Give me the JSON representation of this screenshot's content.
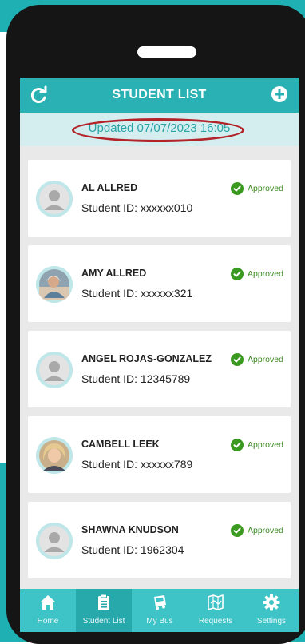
{
  "header": {
    "title": "STUDENT LIST",
    "refresh_icon": "refresh-icon",
    "add_icon": "add-icon"
  },
  "updated": {
    "text": "Updated 07/07/2023 16:05",
    "highlight_color": "#b3232a"
  },
  "students": [
    {
      "name": "AL ALLRED",
      "student_id": "Student ID: xxxxxx010",
      "status": "Approved",
      "avatar": "placeholder"
    },
    {
      "name": "AMY ALLRED",
      "student_id": "Student ID: xxxxxx321",
      "status": "Approved",
      "avatar": "photo"
    },
    {
      "name": "ANGEL ROJAS-GONZALEZ",
      "student_id": "Student ID: 12345789",
      "status": "Approved",
      "avatar": "placeholder"
    },
    {
      "name": "CAMBELL LEEK",
      "student_id": "Student ID: xxxxxx789",
      "status": "Approved",
      "avatar": "photo"
    },
    {
      "name": "SHAWNA KNUDSON",
      "student_id": "Student ID: 1962304",
      "status": "Approved",
      "avatar": "placeholder"
    }
  ],
  "tabs": [
    {
      "label": "Home",
      "icon": "home-icon",
      "active": false
    },
    {
      "label": "Student List",
      "icon": "clipboard-icon",
      "active": true
    },
    {
      "label": "My Bus",
      "icon": "bus-icon",
      "active": false
    },
    {
      "label": "Requests",
      "icon": "map-icon",
      "active": false
    },
    {
      "label": "Settings",
      "icon": "gear-icon",
      "active": false
    }
  ],
  "colors": {
    "brand_teal": "#29b1b3",
    "tab_bar": "#3ec3c6",
    "approved_green": "#3a9a1f"
  }
}
